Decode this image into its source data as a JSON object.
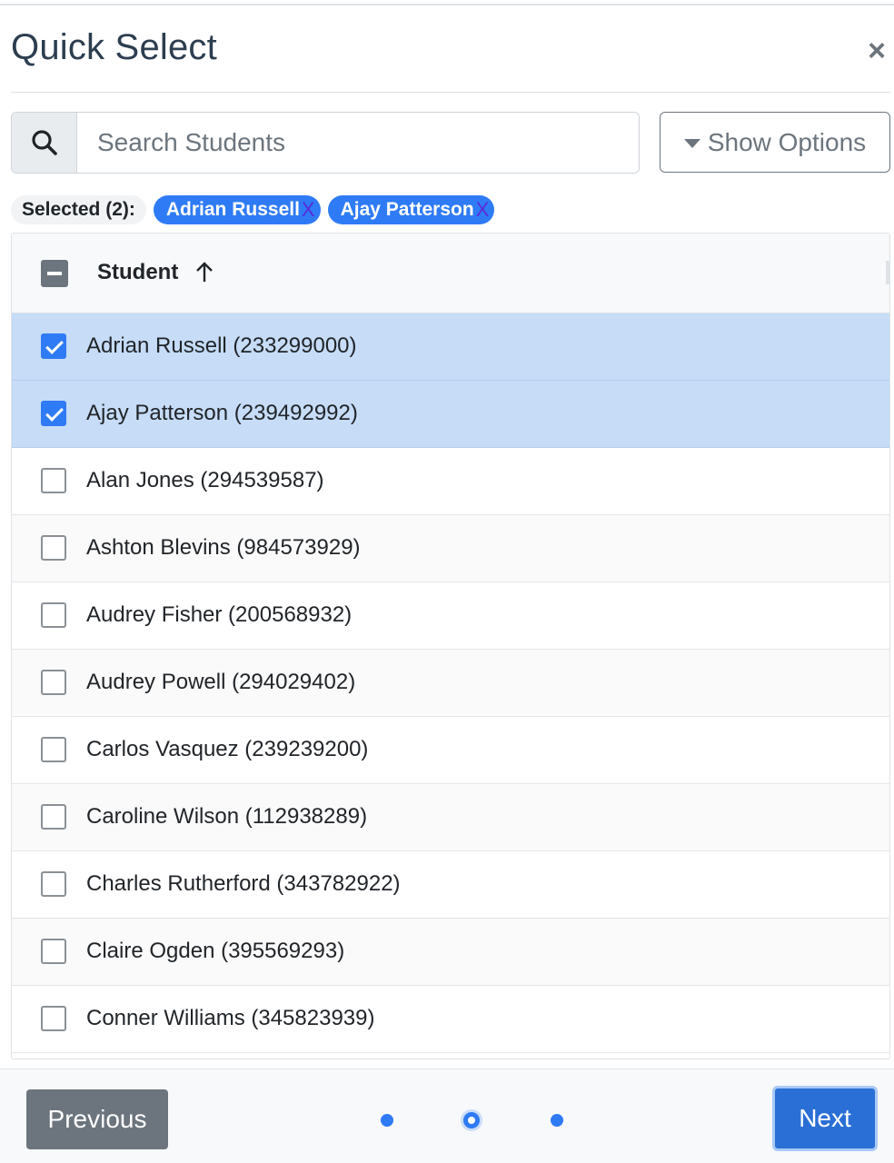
{
  "modal": {
    "title": "Quick Select",
    "close_label": "×"
  },
  "search": {
    "placeholder": "Search Students",
    "value": ""
  },
  "options_button": {
    "label": "Show Options"
  },
  "selected": {
    "label": "Selected (2):",
    "chips": [
      {
        "label": "Adrian Russell",
        "remove": "X"
      },
      {
        "label": "Ajay Patterson",
        "remove": "X"
      }
    ]
  },
  "table": {
    "column_header": "Student",
    "sort_direction": "ascending",
    "header_checkbox_state": "indeterminate",
    "rows": [
      {
        "label": "Adrian Russell (233299000)",
        "checked": true
      },
      {
        "label": "Ajay Patterson (239492992)",
        "checked": true
      },
      {
        "label": "Alan Jones (294539587)",
        "checked": false
      },
      {
        "label": "Ashton Blevins (984573929)",
        "checked": false
      },
      {
        "label": "Audrey Fisher (200568932)",
        "checked": false
      },
      {
        "label": "Audrey Powell (294029402)",
        "checked": false
      },
      {
        "label": "Carlos Vasquez (239239200)",
        "checked": false
      },
      {
        "label": "Caroline Wilson (112938289)",
        "checked": false
      },
      {
        "label": "Charles Rutherford (343782922)",
        "checked": false
      },
      {
        "label": "Claire Ogden (395569293)",
        "checked": false
      },
      {
        "label": "Conner Williams (345823939)",
        "checked": false
      }
    ]
  },
  "footer": {
    "previous_label": "Previous",
    "next_label": "Next",
    "steps_total": 3,
    "active_step": 2
  },
  "colors": {
    "primary": "#2f7bf5",
    "selected_row": "#c6dcf7",
    "secondary": "#6c757d",
    "title": "#2c3e50"
  }
}
